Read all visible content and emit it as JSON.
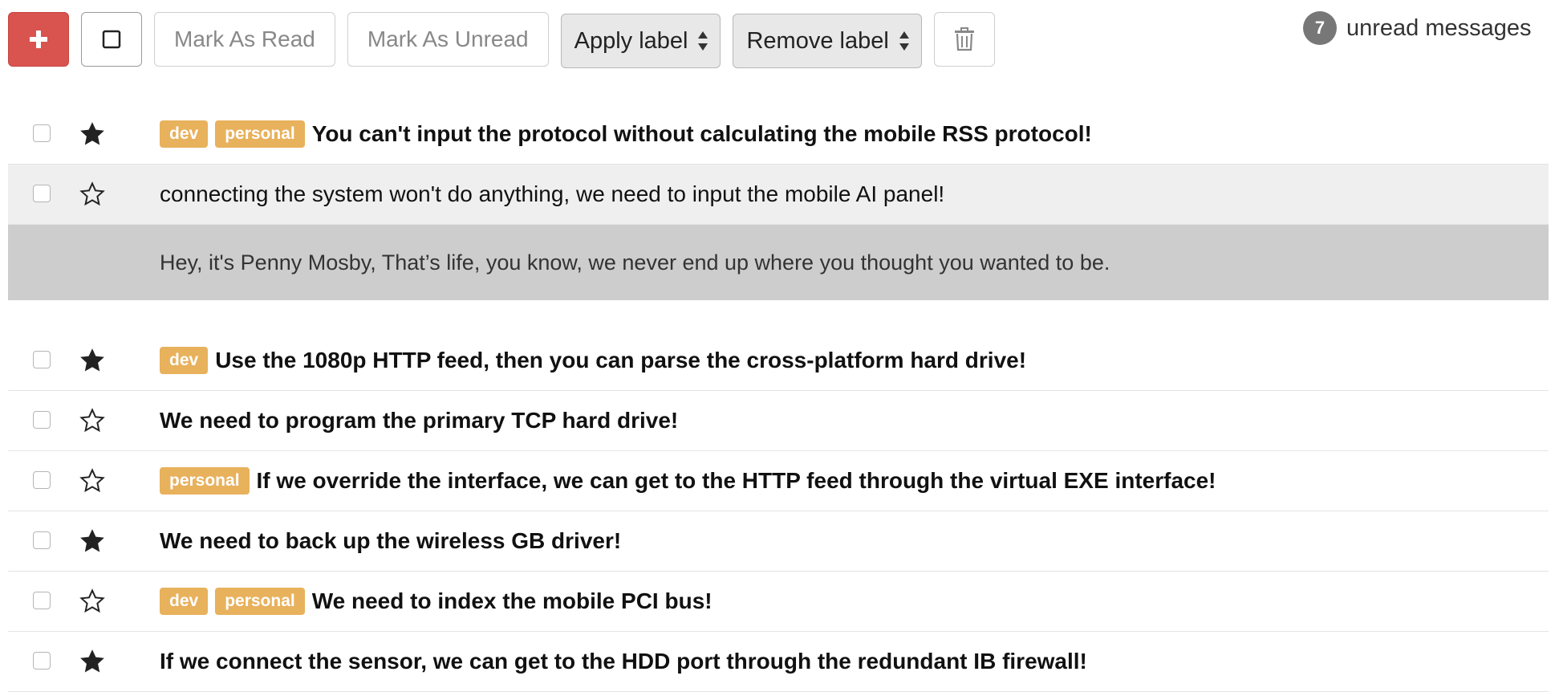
{
  "toolbar": {
    "compose_icon": "plus-icon",
    "select_all_icon": "square-icon",
    "mark_read_label": "Mark As Read",
    "mark_unread_label": "Mark As Unread",
    "apply_label": "Apply label",
    "remove_label": "Remove label",
    "trash_icon": "trash-icon",
    "accent_color": "#d9534f"
  },
  "unread": {
    "count": "7",
    "label": "unread messages"
  },
  "label_color": "#e8b15c",
  "messages": [
    {
      "read": false,
      "starred": true,
      "labels": [
        "dev",
        "personal"
      ],
      "subject": "You can't input the protocol without calculating the mobile RSS protocol!"
    },
    {
      "read": true,
      "starred": false,
      "labels": [],
      "subject": "connecting the system won't do anything, we need to input the mobile AI panel!",
      "expanded_body": "Hey, it's Penny Mosby, That’s life, you know, we never end up where you thought you wanted to be."
    },
    {
      "read": false,
      "starred": true,
      "labels": [
        "dev"
      ],
      "subject": "Use the 1080p HTTP feed, then you can parse the cross-platform hard drive!"
    },
    {
      "read": false,
      "starred": false,
      "labels": [],
      "subject": "We need to program the primary TCP hard drive!"
    },
    {
      "read": false,
      "starred": false,
      "labels": [
        "personal"
      ],
      "subject": "If we override the interface, we can get to the HTTP feed through the virtual EXE interface!"
    },
    {
      "read": false,
      "starred": true,
      "labels": [],
      "subject": "We need to back up the wireless GB driver!"
    },
    {
      "read": false,
      "starred": false,
      "labels": [
        "dev",
        "personal"
      ],
      "subject": "We need to index the mobile PCI bus!"
    },
    {
      "read": false,
      "starred": true,
      "labels": [],
      "subject": "If we connect the sensor, we can get to the HDD port through the redundant IB firewall!"
    }
  ]
}
